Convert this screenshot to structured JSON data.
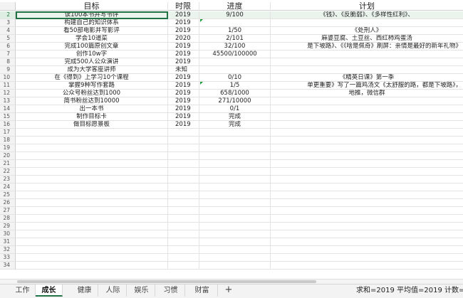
{
  "columns": {
    "a": "目标",
    "b": "时限",
    "c": "进度",
    "d": "计划"
  },
  "rows": [
    {
      "num": "2",
      "a": "读100本书并写书评",
      "b": "2019",
      "c": "9/100",
      "d": "《钱》、《反脆弱》、《多样性红利》、"
    },
    {
      "num": "3",
      "a": "构建自己的知识体系",
      "b": "2019",
      "c": "",
      "d": ""
    },
    {
      "num": "4",
      "a": "看50部电影并写影评",
      "b": "2019",
      "c": "1/50",
      "d": "《处刑人》"
    },
    {
      "num": "5",
      "a": "学会10道菜",
      "b": "2020",
      "c": "2/101",
      "d": "麻婆豆腐、土豆丝、西红柿鸡蛋汤"
    },
    {
      "num": "6",
      "a": "完成100篇原创文章",
      "b": "2019",
      "c": "32/100",
      "d": "是下坡路》、《《啥是佩奇》刷屏：亲情是最好的新年礼物》"
    },
    {
      "num": "7",
      "a": "创作10w字",
      "b": "2019",
      "c": "45500/100000",
      "d": ""
    },
    {
      "num": "8",
      "a": "完成500人公众演讲",
      "b": "2019",
      "c": "",
      "d": ""
    },
    {
      "num": "9",
      "a": "成为大学客座讲师",
      "b": "未知",
      "c": "",
      "d": ""
    },
    {
      "num": "10",
      "a": "在《得到》上学习10个课程",
      "b": "2019",
      "c": "0/10",
      "d": "《精英日课》第一季"
    },
    {
      "num": "11",
      "a": "掌握9种写作套路",
      "b": "2019",
      "c": "1/5",
      "d": "单更重要》写了一篇鸡汤文《太舒服的路，都是下坡路》，"
    },
    {
      "num": "12",
      "a": "公众号粉丝达到1000",
      "b": "2019",
      "c": "658/1000",
      "d": "地推，微信群"
    },
    {
      "num": "13",
      "a": "简书粉丝达到10000",
      "b": "2019",
      "c": "271/10000",
      "d": ""
    },
    {
      "num": "14",
      "a": "出一本书",
      "b": "2019",
      "c": "0/1",
      "d": ""
    },
    {
      "num": "15",
      "a": "制作目标卡",
      "b": "2019",
      "c": "完成",
      "d": ""
    },
    {
      "num": "16",
      "a": "做目标愿景板",
      "b": "2019",
      "c": "完成",
      "d": ""
    },
    {
      "num": "17",
      "a": "",
      "b": "",
      "c": "",
      "d": ""
    },
    {
      "num": "18",
      "a": "",
      "b": "",
      "c": "",
      "d": ""
    },
    {
      "num": "19",
      "a": "",
      "b": "",
      "c": "",
      "d": ""
    },
    {
      "num": "20",
      "a": "",
      "b": "",
      "c": "",
      "d": ""
    },
    {
      "num": "21",
      "a": "",
      "b": "",
      "c": "",
      "d": ""
    },
    {
      "num": "22",
      "a": "",
      "b": "",
      "c": "",
      "d": ""
    },
    {
      "num": "23",
      "a": "",
      "b": "",
      "c": "",
      "d": ""
    },
    {
      "num": "24",
      "a": "",
      "b": "",
      "c": "",
      "d": ""
    },
    {
      "num": "25",
      "a": "",
      "b": "",
      "c": "",
      "d": ""
    },
    {
      "num": "26",
      "a": "",
      "b": "",
      "c": "",
      "d": ""
    },
    {
      "num": "27",
      "a": "",
      "b": "",
      "c": "",
      "d": ""
    },
    {
      "num": "28",
      "a": "",
      "b": "",
      "c": "",
      "d": ""
    },
    {
      "num": "29",
      "a": "",
      "b": "",
      "c": "",
      "d": ""
    },
    {
      "num": "30",
      "a": "",
      "b": "",
      "c": "",
      "d": ""
    },
    {
      "num": "31",
      "a": "",
      "b": "",
      "c": "",
      "d": ""
    },
    {
      "num": "32",
      "a": "",
      "b": "",
      "c": "",
      "d": ""
    },
    {
      "num": "33",
      "a": "",
      "b": "",
      "c": "",
      "d": ""
    },
    {
      "num": "34",
      "a": "",
      "b": "",
      "c": "",
      "d": ""
    }
  ],
  "tabs": [
    {
      "label": "工作"
    },
    {
      "label": "成长"
    },
    {
      "label": "健康"
    },
    {
      "label": "人际"
    },
    {
      "label": "娱乐"
    },
    {
      "label": "习惯"
    },
    {
      "label": "财富"
    }
  ],
  "add_tab_label": "+",
  "status": {
    "text": "求和=2019 平均值=2019 计数=5"
  },
  "colors": {
    "accent": "#217346",
    "selected_row": "#eaf4ec"
  }
}
